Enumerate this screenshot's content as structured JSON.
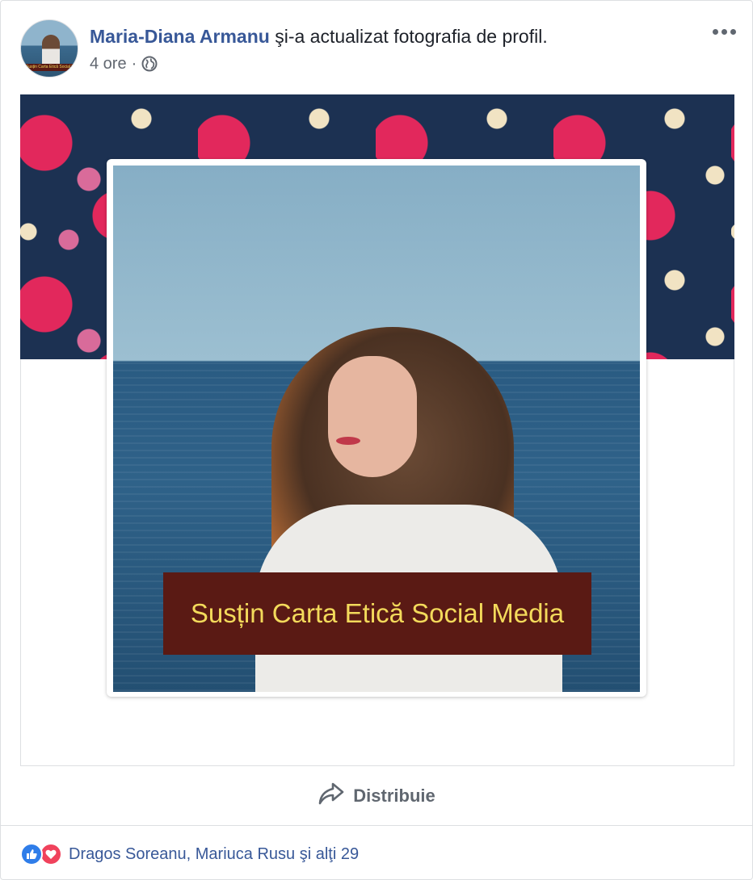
{
  "post": {
    "author": "Maria-Diana Armanu",
    "action": "şi-a actualizat fotografia de profil.",
    "time": "4 ore",
    "separator": "·",
    "privacy_icon": "globe-icon",
    "more_icon": "more-options-icon"
  },
  "avatar": {
    "banner_text": "Susțin Carta Etică Social Media"
  },
  "profile_photo": {
    "banner_text": "Susțin Carta Etică Social Media"
  },
  "actions": {
    "share_label": "Distribuie",
    "share_icon": "share-arrow-icon"
  },
  "reactions": {
    "icons": [
      "like-icon",
      "love-icon"
    ],
    "summary": "Dragos Soreanu, Mariuca Rusu şi alţi 29"
  },
  "colors": {
    "link_blue": "#385898",
    "text_gray": "#616770",
    "like_blue": "#2f7de9",
    "love_red": "#f0425c",
    "banner_bg": "#5a1a14",
    "banner_text": "#f3da5b"
  }
}
